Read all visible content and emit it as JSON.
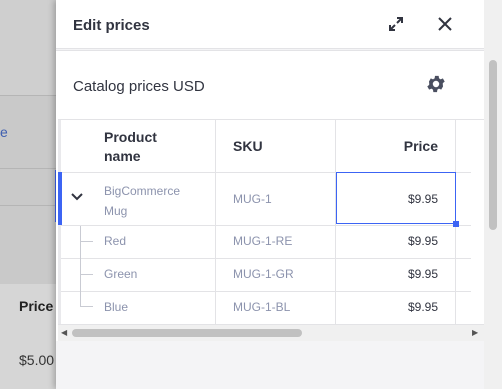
{
  "background": {
    "link_fragment": "e",
    "price_header": "Price",
    "price_value": "$5.00"
  },
  "modal": {
    "title": "Edit prices",
    "icons": {
      "expand": "expand-icon",
      "close": "close-icon",
      "settings": "gear-icon",
      "row_toggle": "chevron-down-icon"
    },
    "card": {
      "title": "Catalog prices USD",
      "columns": [
        "Product name",
        "SKU",
        "Price"
      ],
      "rows": [
        {
          "name": "BigCommerce Mug",
          "sku": "MUG-1",
          "price": "$9.95"
        },
        {
          "name": "Red",
          "sku": "MUG-1-RE",
          "price": "$9.95"
        },
        {
          "name": "Green",
          "sku": "MUG-1-GR",
          "price": "$9.95"
        },
        {
          "name": "Blue",
          "sku": "MUG-1-BL",
          "price": "$9.95"
        }
      ]
    }
  },
  "colors": {
    "accent": "#3c64f4",
    "text": "#313440",
    "muted": "#8c93ad"
  }
}
